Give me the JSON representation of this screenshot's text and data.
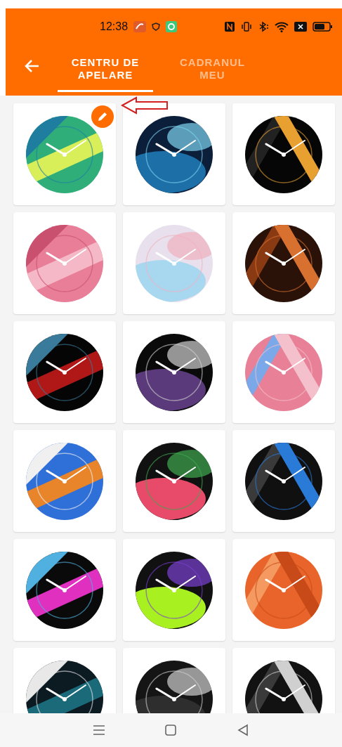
{
  "status_bar": {
    "time": "12:38"
  },
  "tabs": [
    {
      "label": "CENTRU DE APELARE",
      "selected": true
    },
    {
      "label": "CADRANUL MEU",
      "selected": false
    }
  ],
  "faces": [
    {
      "kind": "picture",
      "selected": true
    },
    {
      "kind": "picture",
      "selected": false
    },
    {
      "kind": "picture",
      "selected": false
    },
    {
      "kind": "picture",
      "selected": false
    },
    {
      "kind": "picture",
      "selected": false
    },
    {
      "kind": "picture",
      "selected": false
    },
    {
      "kind": "picture",
      "selected": false
    },
    {
      "kind": "picture",
      "selected": false
    },
    {
      "kind": "picture",
      "selected": false
    },
    {
      "kind": "picture",
      "selected": false
    },
    {
      "kind": "picture",
      "selected": false
    },
    {
      "kind": "picture",
      "selected": false
    },
    {
      "kind": "picture",
      "selected": false
    },
    {
      "kind": "picture",
      "selected": false
    },
    {
      "kind": "picture",
      "selected": false
    },
    {
      "kind": "picture",
      "selected": false
    },
    {
      "kind": "picture",
      "selected": false
    },
    {
      "kind": "picture",
      "selected": false
    }
  ]
}
